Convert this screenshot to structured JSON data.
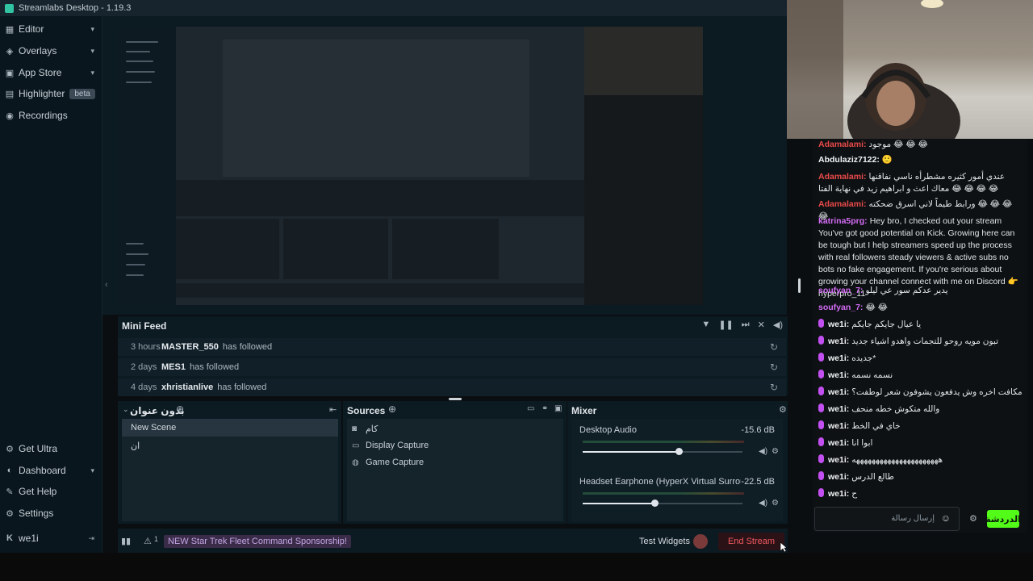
{
  "app": {
    "title": "Streamlabs Desktop - 1.19.3"
  },
  "sidebar": {
    "top": [
      {
        "label": "Editor",
        "icon": "editor-icon",
        "chevron": "⌄"
      },
      {
        "label": "Overlays",
        "icon": "overlays-icon",
        "chevron": "⌄"
      },
      {
        "label": "App Store",
        "icon": "app-store-icon",
        "chevron": "⌄"
      },
      {
        "label": "Highlighter",
        "icon": "highlighter-icon",
        "badge": "beta"
      },
      {
        "label": "Recordings",
        "icon": "recordings-icon"
      }
    ],
    "bottom": [
      {
        "label": "Get Ultra",
        "icon": "ultra-icon"
      },
      {
        "label": "Dashboard",
        "icon": "dashboard-icon",
        "chevron": "⌄"
      },
      {
        "label": "Get Help",
        "icon": "help-icon"
      },
      {
        "label": "Settings",
        "icon": "settings-icon"
      },
      {
        "label": "we1i",
        "icon": "kick-icon"
      }
    ]
  },
  "mini_feed": {
    "title": "Mini Feed",
    "rows": [
      {
        "time": "3 hours",
        "user": "MASTER_550",
        "action": "has followed"
      },
      {
        "time": "2 days",
        "user": "MES1",
        "action": "has followed"
      },
      {
        "time": "4 days",
        "user": "xhristianlive",
        "action": "has followed"
      }
    ]
  },
  "scenes": {
    "title": "بدون عنوان",
    "items": [
      {
        "label": "New Scene",
        "selected": true
      },
      {
        "label": "ان",
        "selected": false
      }
    ]
  },
  "sources": {
    "title": "Sources",
    "items": [
      {
        "label": "كام",
        "icon": "webcam-icon"
      },
      {
        "label": "Display Capture",
        "icon": "display-icon"
      },
      {
        "label": "Game Capture",
        "icon": "gamepad-icon"
      }
    ]
  },
  "mixer": {
    "title": "Mixer",
    "channels": [
      {
        "name": "Desktop Audio",
        "db": "-15.6 dB",
        "level": 0.6
      },
      {
        "name": "Headset Earphone (HyperX Virtual Surround So...",
        "db": "-22.5 dB",
        "level": 0.45
      }
    ]
  },
  "footer": {
    "alert_count": "1",
    "promo": "NEW Star Trek Fleet Command Sponsorship!",
    "test_widgets": "Test Widgets",
    "end_stream": "End Stream"
  },
  "chat": {
    "messages": [
      {
        "user": "Adamalami:",
        "text": "موجود 😂 😂 😂",
        "color": "red",
        "badge": false
      },
      {
        "user": "Abdulaziz7122:",
        "text": "🙂",
        "color": "white",
        "badge": false
      },
      {
        "user": "Adamalami:",
        "text": "عندي أمور كثيره مشطرأه ناسي نفاقنها معاك اعث و ابراهيم زيد في نهاية الفتا 😂 😂 😂 😂",
        "color": "red",
        "badge": false
      },
      {
        "user": "Adamalami:",
        "text": "ورابط طيماً لاني اسرق ضحكته 😂 😂 😂 😂",
        "color": "red",
        "badge": false
      },
      {
        "user": "katrina5prg:",
        "text": "Hey bro, I checked out your stream You've got good potential on Kick. Growing here can be tough but I help streamers speed up the process with real followers steady viewers & active subs no bots no fake engagement. If you're serious about growing your channel connect with me on Discord 👉hyperpro_11",
        "color": "purple",
        "badge": false
      },
      {
        "user": "soufyan_7:",
        "text": "يدير عدكم سور عي ليلو",
        "color": "purple",
        "badge": false
      },
      {
        "user": "soufyan_7:",
        "text": "😂 😂",
        "color": "purple",
        "badge": false
      },
      {
        "user": "we1i:",
        "text": "يا عيال جايكم جايكم",
        "color": "white",
        "badge": true
      },
      {
        "user": "we1i:",
        "text": "تبون مويه روحو للتجمات واهدو اشياء جديد",
        "color": "white",
        "badge": true
      },
      {
        "user": "we1i:",
        "text": "جديده*",
        "color": "white",
        "badge": true
      },
      {
        "user": "we1i:",
        "text": "نسمه نسمه",
        "color": "white",
        "badge": true
      },
      {
        "user": "we1i:",
        "text": "مكافت اخره وش يدفعون يشوفون شعر لوطفت؟",
        "color": "white",
        "badge": true
      },
      {
        "user": "we1i:",
        "text": "والله متكوش خطه منحف",
        "color": "white",
        "badge": true
      },
      {
        "user": "we1i:",
        "text": "خاي في الخط",
        "color": "white",
        "badge": true
      },
      {
        "user": "we1i:",
        "text": "ابوا انا",
        "color": "white",
        "badge": true
      },
      {
        "user": "we1i:",
        "text": "ههههههههههههههههههههههه",
        "color": "white",
        "badge": true
      },
      {
        "user": "we1i:",
        "text": "طالع الدرس",
        "color": "white",
        "badge": true
      },
      {
        "user": "we1i:",
        "text": "ح",
        "color": "white",
        "badge": true
      }
    ],
    "input_placeholder": "إرسال رسالة",
    "send_label": "الدردشة"
  }
}
